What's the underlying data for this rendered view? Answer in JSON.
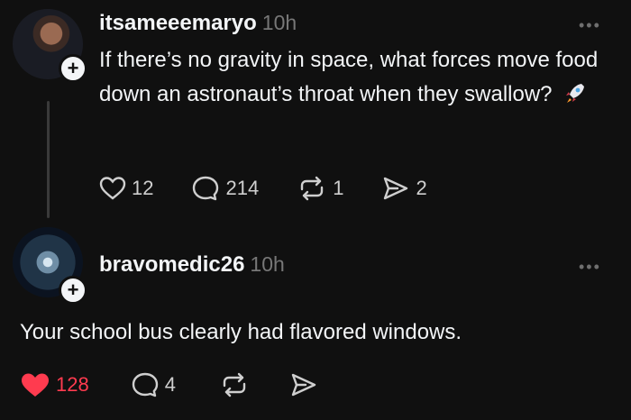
{
  "post": {
    "username": "itsameeemaryo",
    "time": "10h",
    "text": "If there’s no gravity in space, what forces move food down an astronaut’s throat when they swallow?",
    "emoji_icon": "rocket-icon",
    "more": "•••",
    "actions": {
      "likes": "12",
      "replies": "214",
      "reposts": "1",
      "shares": "2"
    }
  },
  "reply": {
    "username": "bravomedic26",
    "time": "10h",
    "text": "Your school bus clearly had flavored windows.",
    "more": "•••",
    "actions": {
      "likes": "128",
      "replies": "4"
    }
  },
  "colors": {
    "background": "#101010",
    "text": "#f3f5f7",
    "muted": "#777777",
    "like": "#ff3b4f"
  }
}
